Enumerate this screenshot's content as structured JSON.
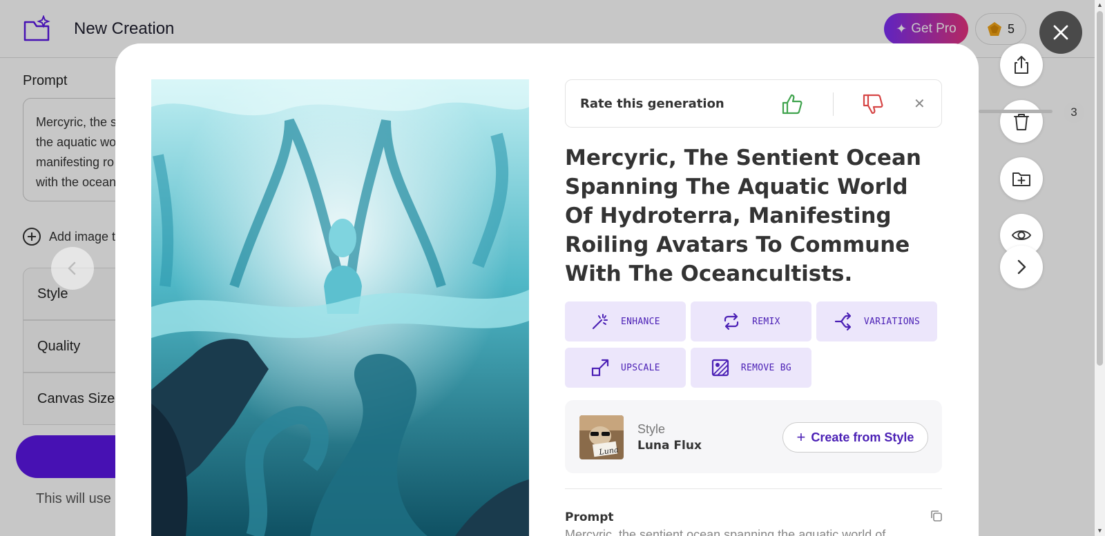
{
  "app": {
    "title": "New Creation",
    "get_pro_label": "Get Pro",
    "credits": "5"
  },
  "left_panel": {
    "prompt_label": "Prompt",
    "prompt_text": "Mercyric, the s\nthe aquatic wo\nmanifesting ro\nwith the ocean",
    "add_image_label": "Add image to",
    "accordions": [
      "Style",
      "Quality",
      "Canvas Size"
    ],
    "credit_note": "This will use"
  },
  "modal": {
    "rate_label": "Rate this generation",
    "title": "Mercyric, The Sentient Ocean Spanning The Aquatic World Of Hydroterra, Manifesting Roiling Avatars To Commune With The Oceancultists.",
    "actions": [
      {
        "label": "ENHANCE",
        "icon": "magic-wand-icon"
      },
      {
        "label": "REMIX",
        "icon": "repeat-icon"
      },
      {
        "label": "VARIATIONS",
        "icon": "split-arrows-icon"
      },
      {
        "label": "UPSCALE",
        "icon": "expand-arrow-icon"
      },
      {
        "label": "REMOVE BG",
        "icon": "remove-background-icon"
      }
    ],
    "style": {
      "kicker": "Style",
      "name": "Luna Flux",
      "thumb_caption": "Luna",
      "create_label": "Create from Style"
    },
    "prompt_label": "Prompt",
    "prompt_text": "Mercyric, the sentient ocean spanning the aquatic world of"
  },
  "pagination": {
    "count": "3"
  },
  "colors": {
    "accent": "#5b17e6",
    "action_bg": "#ece6fb",
    "action_text": "#4b20b5",
    "thumb_up": "#3fa34d",
    "thumb_down": "#d64545"
  }
}
